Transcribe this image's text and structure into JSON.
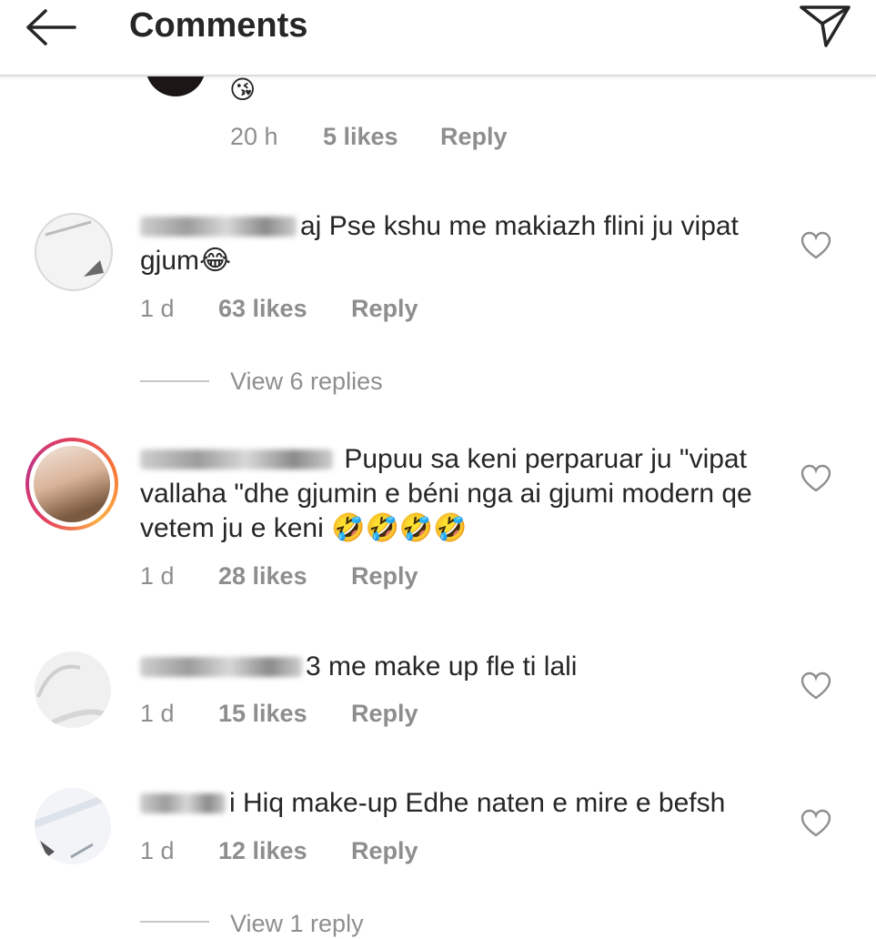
{
  "header": {
    "title": "Comments",
    "back_icon": "arrow-left-icon",
    "share_icon": "paper-plane-icon"
  },
  "comments": [
    {
      "text": "😘",
      "time": "20 h",
      "likes": "5 likes",
      "reply": "Reply"
    },
    {
      "username_visible": "aj",
      "text": "Pse kshu me makiazh flini ju vipat gjum😂",
      "time": "1 d",
      "likes": "63 likes",
      "reply": "Reply",
      "view_replies": "View 6 replies"
    },
    {
      "username_visible": "",
      "text": "Pupuu sa keni perparuar ju \"vipat vallaha \"dhe gjumin e béni nga ai gjumi modern qe vetem ju e keni 🤣🤣🤣🤣",
      "time": "1 d",
      "likes": "28 likes",
      "reply": "Reply"
    },
    {
      "username_visible": "3",
      "text": "me make up fle ti lali",
      "time": "1 d",
      "likes": "15 likes",
      "reply": "Reply"
    },
    {
      "username_visible": "i",
      "text": "Hiq make-up Edhe naten e mire e befsh",
      "time": "1 d",
      "likes": "12 likes",
      "reply": "Reply",
      "view_replies": "View 1 reply"
    }
  ],
  "colors": {
    "text": "#262626",
    "muted": "#8e8e8e",
    "divider": "#dbdbdb"
  }
}
